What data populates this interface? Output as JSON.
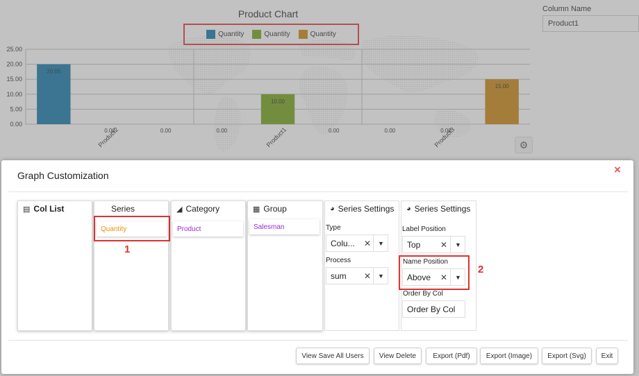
{
  "chart": {
    "title": "Product Chart",
    "legend": [
      {
        "label": "Quantity",
        "color": "#0a73a8"
      },
      {
        "label": "Quantity",
        "color": "#6f9f12"
      },
      {
        "label": "Quantity",
        "color": "#c88208"
      }
    ]
  },
  "chart_data": {
    "type": "bar",
    "title": "Product Chart",
    "ylim": [
      0,
      25
    ],
    "y_ticks": [
      "25.00",
      "20.00",
      "15.00",
      "10.00",
      "5.00",
      "0.00"
    ],
    "categories": [
      "Product2",
      "Product1",
      "Product3"
    ],
    "series": [
      {
        "name": "Quantity",
        "color": "#0a73a8",
        "values": [
          20,
          0,
          0
        ]
      },
      {
        "name": "Quantity",
        "color": "#6f9f12",
        "values": [
          0,
          10,
          0
        ]
      },
      {
        "name": "Quantity",
        "color": "#c88208",
        "values": [
          0,
          0,
          15
        ]
      }
    ],
    "bar_labels": [
      [
        "20.00",
        "0.00",
        "0.00"
      ],
      [
        "0.00",
        "10.00",
        "0.00"
      ],
      [
        "0.00",
        "0.00",
        "15.00"
      ]
    ],
    "grid": true
  },
  "column_name": {
    "label": "Column Name",
    "value": "Product1"
  },
  "modal": {
    "title": "Graph Customization",
    "close": "×",
    "panels": {
      "col_list": {
        "title": "Col List",
        "icon": "▤"
      },
      "series": {
        "title": "Series",
        "item": "Quantity",
        "item_color": "#e8940a"
      },
      "category": {
        "title": "Category",
        "icon": "◢",
        "item": "Product",
        "item_color": "#9b2bd6"
      },
      "group": {
        "title": "Group",
        "icon": "▦",
        "item": "Salesman",
        "item_color": "#9b2bd6"
      }
    },
    "settings_1": {
      "title": "Series Settings",
      "type_label": "Type",
      "type_value": "Colu...",
      "process_label": "Process",
      "process_value": "sum"
    },
    "settings_2": {
      "title": "Series Settings",
      "label_position_label": "Label Position",
      "label_position_value": "Top",
      "name_position_label": "Name Position",
      "name_position_value": "Above",
      "order_by_label": "Order By Col",
      "order_by_placeholder": "Order By Col"
    },
    "annotations": {
      "one": "1",
      "two": "2"
    },
    "buttons": {
      "view_save_all": "View Save All Users",
      "view_delete": "View Delete",
      "export_pdf": "Export (Pdf)",
      "export_image": "Export (Image)",
      "export_svg": "Export (Svg)",
      "exit": "Exit"
    }
  }
}
